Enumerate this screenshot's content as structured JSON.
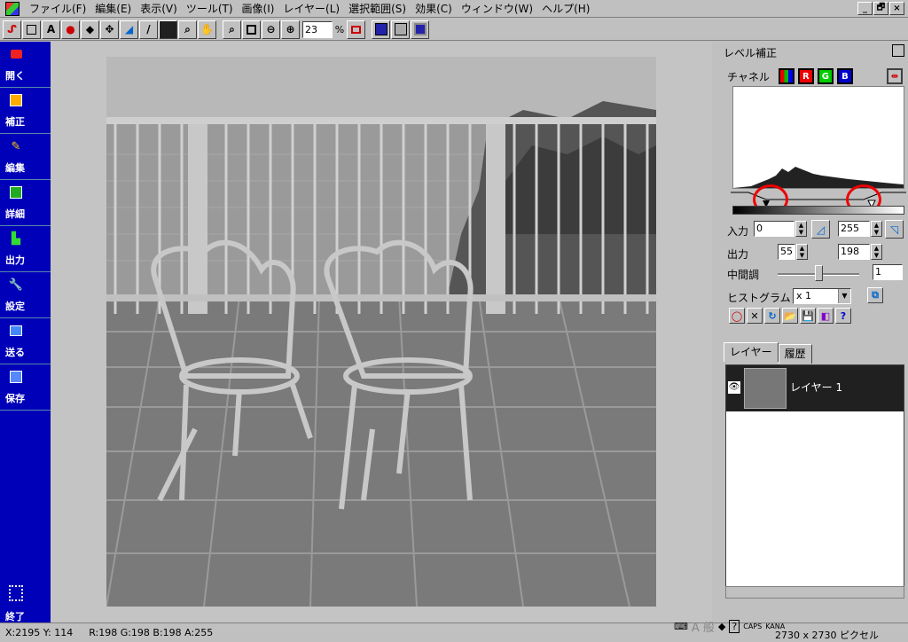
{
  "menubar": {
    "items": [
      "ファイル(F)",
      "編集(E)",
      "表示(V)",
      "ツール(T)",
      "画像(I)",
      "レイヤー(L)",
      "選択範囲(S)",
      "効果(C)",
      "ウィンドウ(W)",
      "ヘルプ(H)"
    ],
    "win_min": "_",
    "win_restore": "🗗",
    "win_close": "×"
  },
  "toolbar": {
    "zoom_value": "23",
    "zoom_unit": "%",
    "text_tool": "A"
  },
  "leftbar": {
    "items": [
      {
        "label": "開く",
        "icon": "camera-icon"
      },
      {
        "label": "補正",
        "icon": "adjust-icon"
      },
      {
        "label": "編集",
        "icon": "pen-icon"
      },
      {
        "label": "詳細",
        "icon": "detail-icon"
      },
      {
        "label": "出力",
        "icon": "output-icon"
      },
      {
        "label": "設定",
        "icon": "wrench-icon"
      },
      {
        "label": "送る",
        "icon": "send-icon"
      },
      {
        "label": "保存",
        "icon": "floppy-icon"
      }
    ],
    "exit_label": "終了"
  },
  "level_panel": {
    "title": "レベル補正",
    "channel_label": "チャネル",
    "channels": [
      "R",
      "G",
      "B"
    ],
    "input_label": "入力",
    "input_low": "0",
    "input_high": "255",
    "output_label": "出力",
    "output_low": "55",
    "output_high": "198",
    "midtone_label": "中間調",
    "midtone_value": "1",
    "histogram_label": "ヒストグラム",
    "histogram_scale": "x 1"
  },
  "layers_panel": {
    "tabs": [
      "レイヤー",
      "履歴"
    ],
    "layer_name": "レイヤー 1"
  },
  "status": {
    "coords": "X:2195 Y: 114",
    "rgba": "R:198 G:198 B:198 A:255",
    "pixel_size": "2730 x 2730 ピクセル",
    "ime": "A 般",
    "caps": "CAPS",
    "kana": "KANA"
  },
  "colors": {
    "leftbar_bg": "#0000b8",
    "annotation_red": "#e00000"
  }
}
